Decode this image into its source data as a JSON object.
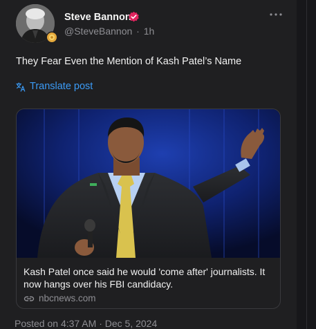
{
  "author": {
    "display_name": "Steve Bannon",
    "handle": "@SteveBannon",
    "separator": "·",
    "time_ago": "1h",
    "avatar_icon": "profile-photo",
    "verified_icon": "verified-badge-icon",
    "verified_color": "#e0245e"
  },
  "post": {
    "text": "They Fear Even the Mention of Kash Patel’s Name",
    "translate_label": "Translate post",
    "translate_icon": "translate-icon",
    "more_icon": "more-options-icon"
  },
  "link_card": {
    "title": "Kash Patel once said he would 'come after' journalists. It now hangs over his FBI candidacy.",
    "domain": "nbcnews.com",
    "link_icon": "link-icon"
  },
  "footer": {
    "posted": "Posted on 4:37 AM · Dec 5, 2024"
  },
  "colors": {
    "accent": "#3b9bf6",
    "background": "#1f1f21",
    "muted_text": "#8e8e93"
  }
}
